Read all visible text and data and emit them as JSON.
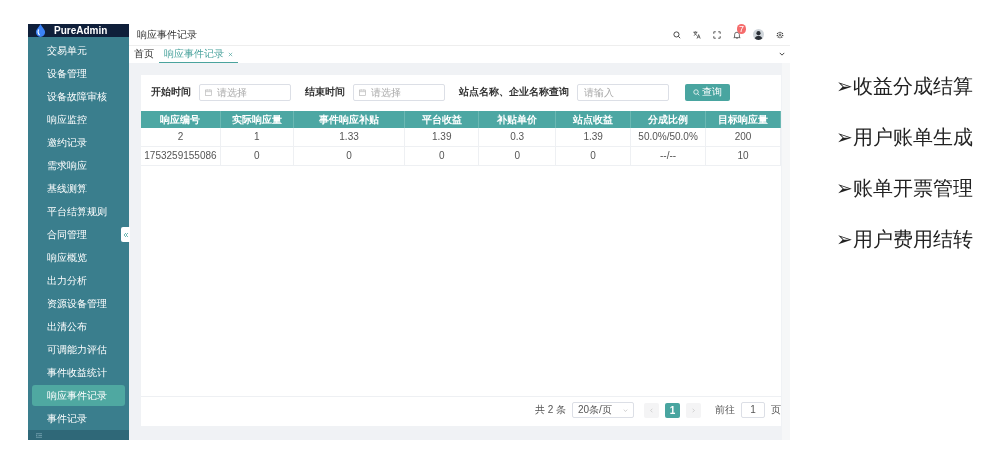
{
  "sidebar": {
    "brand": "PureAdmin",
    "items": [
      {
        "label": "交易单元",
        "selected": false
      },
      {
        "label": "设备管理",
        "selected": false
      },
      {
        "label": "设备故障审核",
        "selected": false
      },
      {
        "label": "响应监控",
        "selected": false
      },
      {
        "label": "邀约记录",
        "selected": false
      },
      {
        "label": "需求响应",
        "selected": false
      },
      {
        "label": "基线测算",
        "selected": false
      },
      {
        "label": "平台结算规则",
        "selected": false
      },
      {
        "label": "合同管理",
        "selected": false
      },
      {
        "label": "响应概览",
        "selected": false
      },
      {
        "label": "出力分析",
        "selected": false
      },
      {
        "label": "资源设备管理",
        "selected": false
      },
      {
        "label": "出清公布",
        "selected": false
      },
      {
        "label": "可调能力评估",
        "selected": false
      },
      {
        "label": "事件收益统计",
        "selected": false
      },
      {
        "label": "响应事件记录",
        "selected": true
      },
      {
        "label": "事件记录",
        "selected": false
      }
    ]
  },
  "header": {
    "breadcrumb": "响应事件记录",
    "notification_count": "7"
  },
  "tabs": [
    {
      "label": "首页",
      "selected": false,
      "closable": false
    },
    {
      "label": "响应事件记录",
      "selected": true,
      "closable": true
    }
  ],
  "filters": [
    {
      "label": "开始时间",
      "placeholder": "请选择",
      "kind": "date"
    },
    {
      "label": "结束时间",
      "placeholder": "请选择",
      "kind": "date"
    },
    {
      "label": "站点名称、企业名称查询",
      "placeholder": "请输入",
      "kind": "text"
    }
  ],
  "search_button": "查询",
  "table": {
    "columns": [
      "响应编号",
      "实际响应量",
      "事件响应补贴",
      "平台收益",
      "补贴单价",
      "站点收益",
      "分成比例",
      "目标响应量"
    ],
    "rows": [
      [
        "2",
        "1",
        "1.33",
        "1.39",
        "0.3",
        "1.39",
        "50.0%/50.0%",
        "200"
      ],
      [
        "1753259155086",
        "0",
        "0",
        "0",
        "0",
        "0",
        "--/--",
        "10"
      ]
    ]
  },
  "pagination": {
    "total": "共 2 条",
    "page_size": "20条/页",
    "pages": [
      {
        "label": "1",
        "selected": true
      }
    ],
    "jump_label": "前往",
    "jump_value": "1",
    "jump_suffix": "页"
  },
  "bullets": [
    "➢收益分成结算",
    "➢用户账单生成",
    "➢账单开票管理",
    "➢用户费用结转"
  ]
}
